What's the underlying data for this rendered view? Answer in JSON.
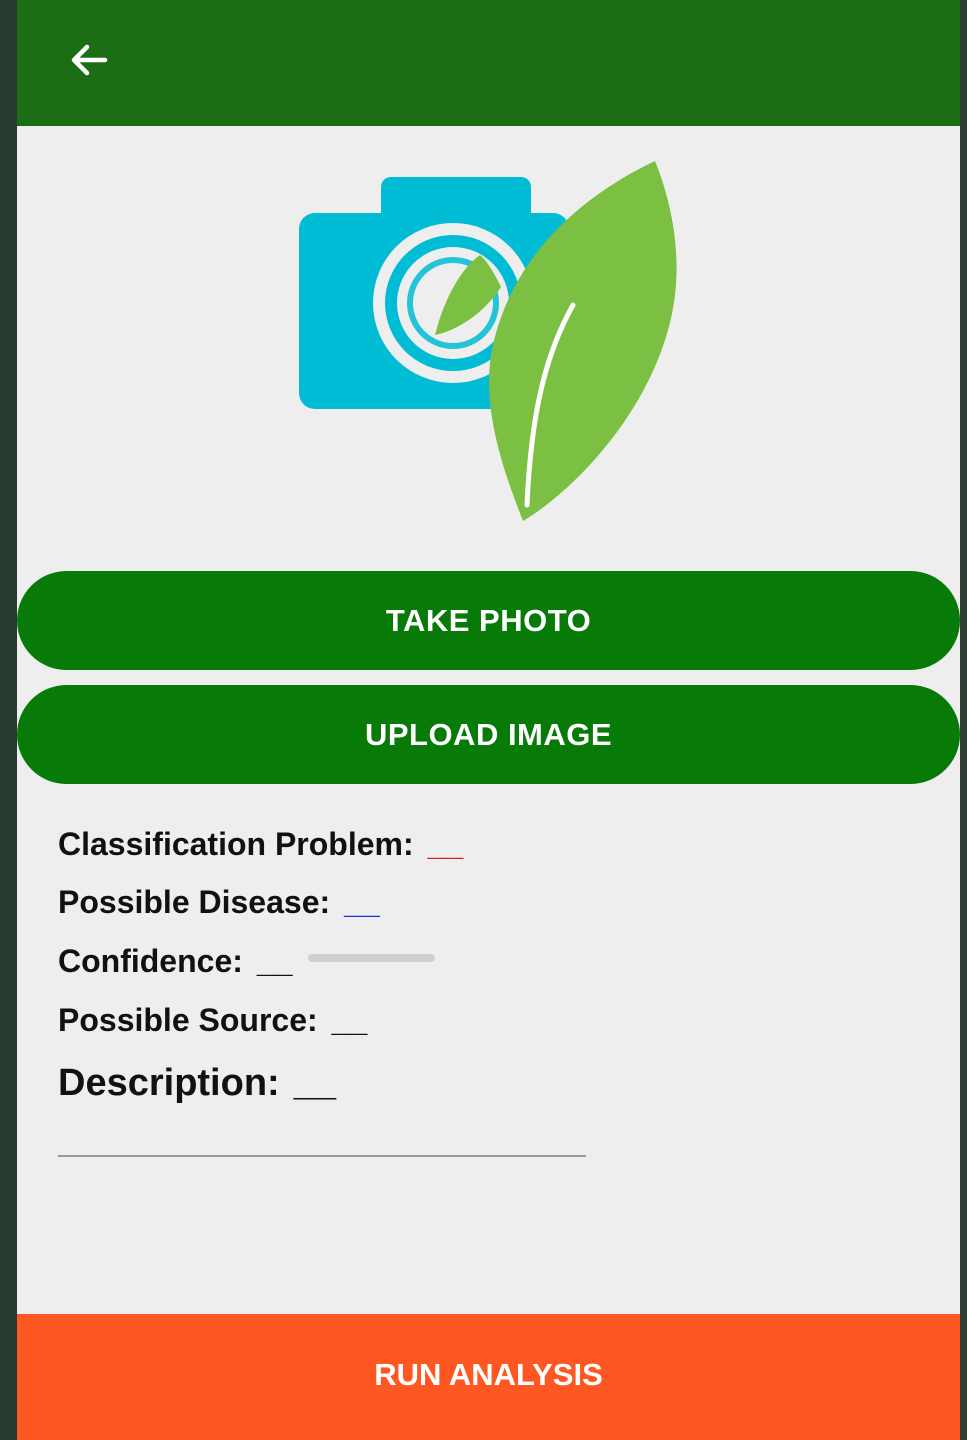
{
  "appbar": {
    "back_icon": "arrow-left-icon",
    "color": "#1b6e14"
  },
  "logo": {
    "icon": "camera-leaf-logo",
    "camera_color": "#00bcd4",
    "leaf_color": "#7cc043"
  },
  "buttons": {
    "take_photo": "TAKE PHOTO",
    "upload_image": "UPLOAD IMAGE",
    "run_analysis": "RUN ANALYSIS",
    "primary_color": "#077a07",
    "accent_color": "#ff5722"
  },
  "results": {
    "classification_label": "Classification Problem:",
    "classification_value": "__",
    "disease_label": "Possible Disease:",
    "disease_value": "__",
    "confidence_label": "Confidence:",
    "confidence_value": "__",
    "confidence_progress": 0,
    "source_label": "Possible Source:",
    "source_value": "__",
    "description_label": "Description:",
    "description_value": "__"
  }
}
